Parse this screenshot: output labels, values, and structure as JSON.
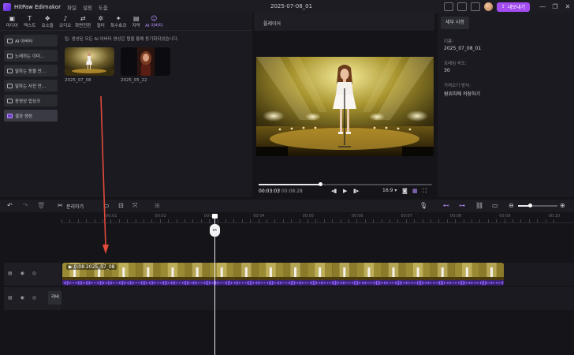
{
  "titlebar": {
    "app_name": "HitPaw Edimakor",
    "menu": [
      "파일",
      "설정",
      "도움"
    ],
    "document_title": "2025-07-08_01",
    "export_label": "내보내기",
    "window_controls": [
      "—",
      "❐",
      "✕"
    ]
  },
  "tool_tabs": [
    {
      "label": "미디어",
      "icon": "media-icon",
      "glyph": "▣"
    },
    {
      "label": "텍스트",
      "icon": "text-icon",
      "glyph": "T"
    },
    {
      "label": "요소들",
      "icon": "elements-icon",
      "glyph": "❖"
    },
    {
      "label": "오디오",
      "icon": "audio-icon",
      "glyph": "♪"
    },
    {
      "label": "화면전환",
      "icon": "transition-icon",
      "glyph": "⇄"
    },
    {
      "label": "필터",
      "icon": "filter-icon",
      "glyph": "✲"
    },
    {
      "label": "특수효과",
      "icon": "effects-icon",
      "glyph": "✦"
    },
    {
      "label": "자막",
      "icon": "subtitle-icon",
      "glyph": "▤"
    },
    {
      "label": "AI 아바타",
      "icon": "ai-avatar-icon",
      "glyph": "☺",
      "active": true
    }
  ],
  "side_menu": [
    {
      "label": "AI 아바타",
      "active": false
    },
    {
      "label": "노래하는 이미...",
      "active": false
    },
    {
      "label": "말하는 동물 만...",
      "active": false
    },
    {
      "label": "말하는 사진 만...",
      "active": false
    },
    {
      "label": "동영상 립싱크",
      "active": false
    },
    {
      "label": "결과 생성",
      "active": true
    }
  ],
  "tip": "팁: 생성된 모든 AI 아바타 영상은 탭을 통해 동기화되었습니다.",
  "results": [
    {
      "label": "2025_07_08"
    },
    {
      "label": "2025_05_22"
    }
  ],
  "player": {
    "tab_label": "플레이어",
    "current_time": "00:03:03",
    "total_time": "/ 00:08:28",
    "aspect": "16:9",
    "progress": 0.36
  },
  "details": {
    "tab_label": "세부 사항",
    "name_label": "이름:",
    "name_value": "2025_07_08_01",
    "fps_label": "프레임 속도:",
    "fps_value": "30",
    "import_label": "가져오기 방식:",
    "import_value": "원위치에 저장하기"
  },
  "timeline_toolbar": {
    "split_label": "분리하기"
  },
  "ruler": {
    "labels": [
      "00:01",
      "00:02",
      "00:03",
      "00:04",
      "00:05",
      "00:06",
      "00:07",
      "00:08",
      "00:09",
      "00:10"
    ]
  },
  "tracks": {
    "cover_label": "커버",
    "clip_label": "0:08 2025_07_08"
  },
  "colors": {
    "accent": "#a34df0",
    "active_tab": "#b88cff",
    "annotation_arrow": "#e24a3b",
    "audio_wave": "#8b5cf6"
  }
}
